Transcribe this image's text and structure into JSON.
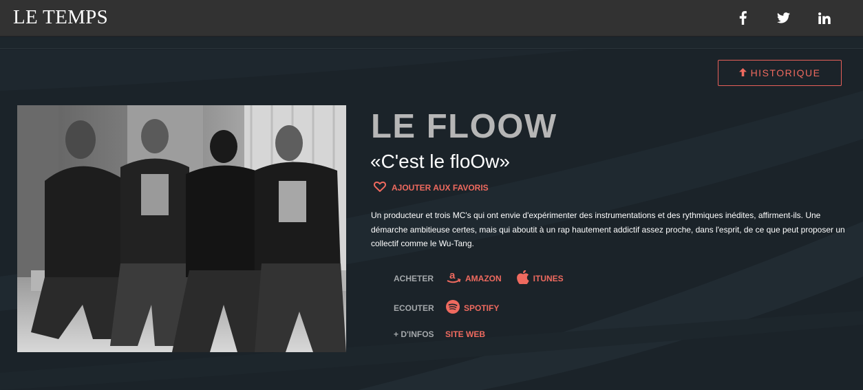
{
  "header": {
    "brand": "LE TEMPS",
    "social": [
      "facebook-icon",
      "twitter-icon",
      "linkedin-icon"
    ]
  },
  "history_button": {
    "label": "HISTORIQUE",
    "icon": "arrow-up-icon"
  },
  "artist": {
    "name": "LE FLOOW",
    "quote": "«C'est le floOw»",
    "favorite_label": "AJOUTER AUX FAVORIS",
    "description": "Un producteur et trois MC's qui ont envie d'expérimenter des instrumentations et des rythmiques inédites, affirment-ils. Une démarche ambitieuse certes, mais qui aboutit à un rap hautement addictif assez proche, dans l'esprit, de ce que peut proposer un collectif comme le Wu-Tang."
  },
  "links": {
    "buy_label": "ACHETER",
    "amazon": "AMAZON",
    "itunes": "ITUNES",
    "listen_label": "ECOUTER",
    "spotify": "SPOTIFY",
    "info_label": "+ D'INFOS",
    "website": "SITE WEB"
  },
  "colors": {
    "accent": "#ef6a5f",
    "background": "#1b2329",
    "topbar": "#323232",
    "title": "#b6b6b6"
  }
}
